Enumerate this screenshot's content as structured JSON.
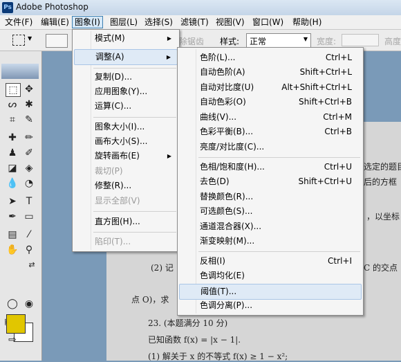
{
  "window": {
    "title": "Adobe Photoshop",
    "logo_text": "Ps"
  },
  "menubar": [
    {
      "label": "文件(F)"
    },
    {
      "label": "编辑(E)"
    },
    {
      "label": "图象(I)"
    },
    {
      "label": "图层(L)"
    },
    {
      "label": "选择(S)"
    },
    {
      "label": "滤镜(T)"
    },
    {
      "label": "视图(V)"
    },
    {
      "label": "窗口(W)"
    },
    {
      "label": "帮助(H)"
    }
  ],
  "options_bar": {
    "feather_label": "除锯齿",
    "style_label": "样式:",
    "style_value": "正常",
    "width_label": "宽度:",
    "height_label": "高度"
  },
  "image_menu": [
    {
      "label": "模式(M)",
      "submenu": true
    },
    {
      "label": "调整(A)",
      "submenu": true
    },
    {
      "label": "复制(D)..."
    },
    {
      "label": "应用图象(Y)..."
    },
    {
      "label": "运算(C)..."
    },
    {
      "label": "图象大小(I)..."
    },
    {
      "label": "画布大小(S)..."
    },
    {
      "label": "旋转画布(E)",
      "submenu": true
    },
    {
      "label": "裁切(P)"
    },
    {
      "label": "修整(R)..."
    },
    {
      "label": "显示全部(V)"
    },
    {
      "label": "直方图(H)..."
    },
    {
      "label": "陷印(T)..."
    }
  ],
  "adjust_menu": [
    {
      "label": "色阶(L)...",
      "shortcut": "Ctrl+L"
    },
    {
      "label": "自动色阶(A)",
      "shortcut": "Shift+Ctrl+L"
    },
    {
      "label": "自动对比度(U)",
      "shortcut": "Alt+Shift+Ctrl+L"
    },
    {
      "label": "自动色彩(O)",
      "shortcut": "Shift+Ctrl+B"
    },
    {
      "label": "曲线(V)...",
      "shortcut": "Ctrl+M"
    },
    {
      "label": "色彩平衡(B)...",
      "shortcut": "Ctrl+B"
    },
    {
      "label": "亮度/对比度(C)...",
      "shortcut": ""
    },
    {
      "label": "色相/饱和度(H)...",
      "shortcut": "Ctrl+U"
    },
    {
      "label": "去色(D)",
      "shortcut": "Shift+Ctrl+U"
    },
    {
      "label": "替换颜色(R)...",
      "shortcut": ""
    },
    {
      "label": "可选颜色(S)...",
      "shortcut": ""
    },
    {
      "label": "通道混合器(X)...",
      "shortcut": ""
    },
    {
      "label": "渐变映射(M)...",
      "shortcut": ""
    },
    {
      "label": "反相(I)",
      "shortcut": "Ctrl+I"
    },
    {
      "label": "色调均化(E)",
      "shortcut": ""
    },
    {
      "label": "阈值(T)...",
      "shortcut": ""
    },
    {
      "label": "色调分离(P)...",
      "shortcut": ""
    }
  ],
  "document": {
    "lines": [
      "选定的题目",
      "后的方框",
      "，以坐标",
      "(2) 记",
      "C 的交点",
      "点 O)，求",
      "23. (本题满分 10 分)",
      "已知函数 f(x) = |x − 1|.",
      "(1) 解关于 x 的不等式 f(x) ≥ 1 − x²;"
    ]
  },
  "colors": {
    "foreground": "#e1c600",
    "background": "#ffffff",
    "menu_highlight": "#dfeaf6"
  },
  "arrow_glyph": "▶"
}
